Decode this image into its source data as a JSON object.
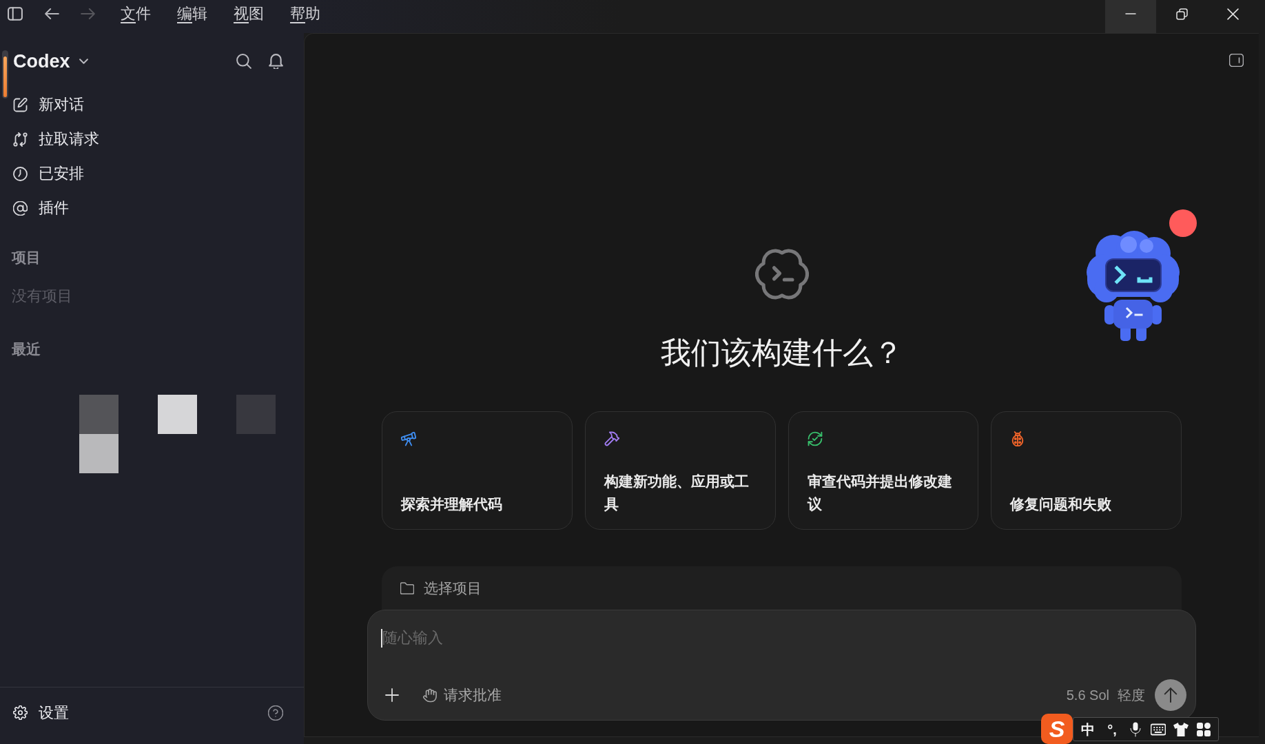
{
  "title_bar": {
    "back": {
      "disabled": false
    },
    "forward": {
      "disabled": true
    },
    "menus": [
      "文件",
      "编辑",
      "视图",
      "帮助"
    ],
    "window_controls": [
      {
        "kind": "minimize",
        "hovered": true
      },
      {
        "kind": "restore",
        "hovered": false
      },
      {
        "kind": "close",
        "hovered": false
      }
    ]
  },
  "sidebar": {
    "app_name": "Codex",
    "items": [
      {
        "kind": "new-chat",
        "label": "新对话",
        "selected": false
      },
      {
        "kind": "pull-requests",
        "label": "拉取请求",
        "selected": false
      },
      {
        "kind": "scheduled",
        "label": "已安排",
        "selected": false
      },
      {
        "kind": "plugins",
        "label": "插件",
        "selected": false
      }
    ],
    "sections": [
      {
        "title": "项目",
        "empty_text": "没有项目"
      },
      {
        "title": "最近",
        "redacted": true
      }
    ],
    "footer": {
      "label": "设置"
    }
  },
  "main": {
    "heading": "我们该构建什么？",
    "mascot": {
      "notification": true
    },
    "cards": [
      {
        "kind": "explore",
        "label": "探索并理解代码",
        "color": "#3f8ef2"
      },
      {
        "kind": "build",
        "label": "构建新功能、应用或工具",
        "color": "#a07cf0"
      },
      {
        "kind": "review",
        "label": "审查代码并提出修改建议",
        "color": "#38c06c"
      },
      {
        "kind": "fix",
        "label": "修复问题和失败",
        "color": "#f0642a"
      }
    ],
    "project_picker": {
      "label": "选择项目"
    },
    "composer": {
      "placeholder": "随心输入",
      "focused": true,
      "approval": "请求批准",
      "model": "5.6 Sol",
      "effort": "轻度"
    }
  },
  "ime_toolbar": {
    "logo": "S",
    "mode": "中",
    "punctuation": "°,"
  }
}
